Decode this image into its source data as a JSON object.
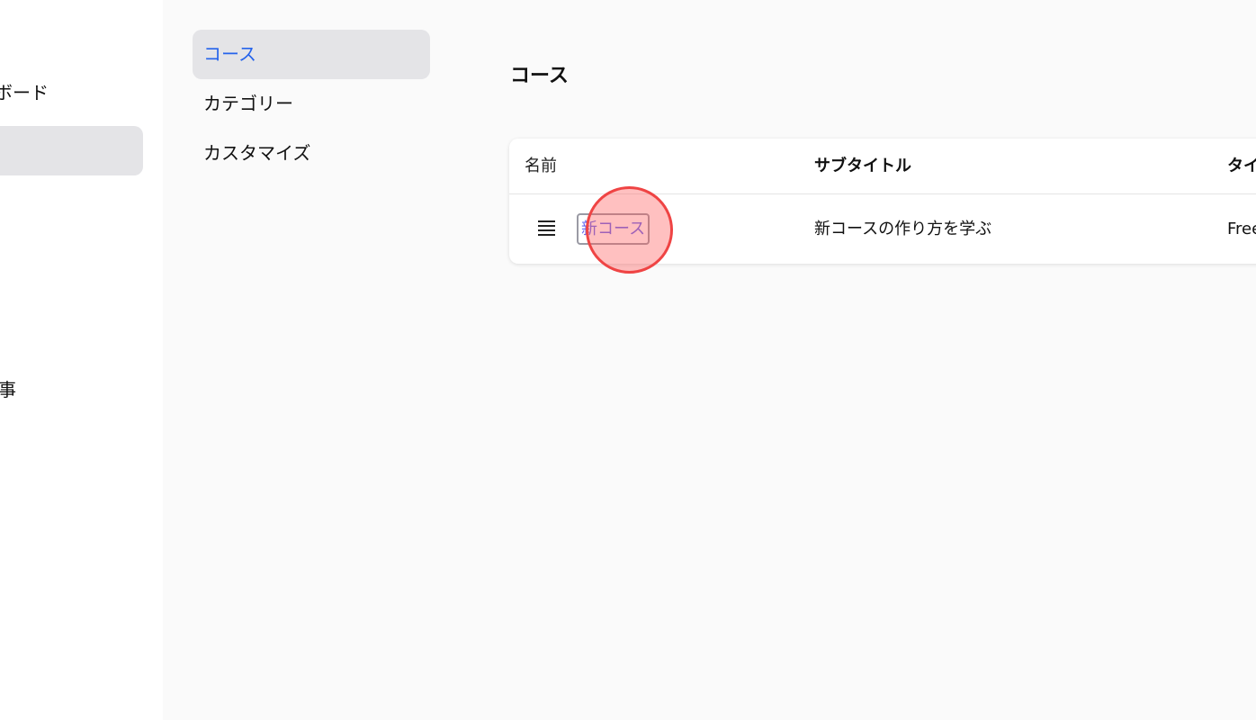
{
  "sidebar": {
    "partial_top": "ʻ",
    "items": [
      {
        "label": "ボード"
      },
      {
        "label": ""
      },
      {
        "label": "事"
      }
    ]
  },
  "subnav": {
    "items": [
      {
        "label": "コース",
        "active": true
      },
      {
        "label": "カテゴリー",
        "active": false
      },
      {
        "label": "カスタマイズ",
        "active": false
      }
    ]
  },
  "page": {
    "title": "コース"
  },
  "table": {
    "columns": [
      "名前",
      "サブタイトル",
      "タイ"
    ],
    "rows": [
      {
        "name": "新コース",
        "subtitle": "新コースの作り方を学ぶ",
        "type": "Free"
      }
    ]
  },
  "colors": {
    "accent": "#2563eb",
    "link": "#6366f1",
    "active_bg": "#e4e4e7",
    "click_marker": "#ef4444"
  }
}
